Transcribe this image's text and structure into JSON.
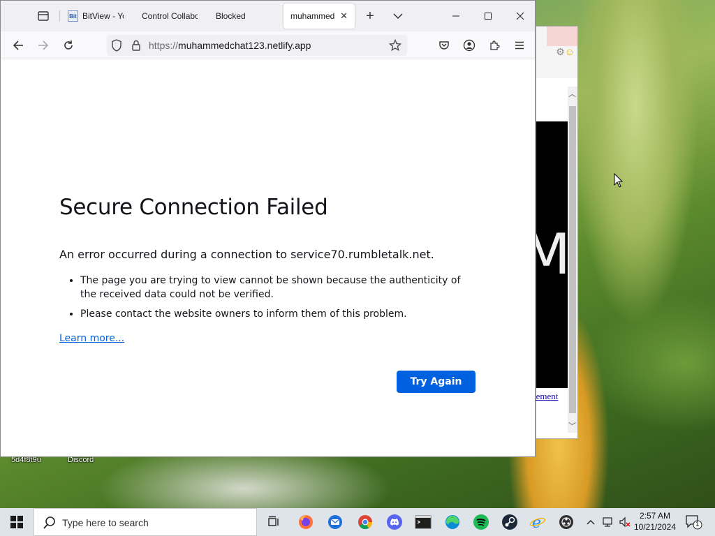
{
  "browser": {
    "tabs": [
      {
        "label": "BitView - Yo",
        "favicon": "Bit",
        "active": false
      },
      {
        "label": "Control Collabo",
        "active": false
      },
      {
        "label": "Blocked",
        "active": false
      },
      {
        "label": "muhammed",
        "active": true
      }
    ],
    "url": {
      "scheme": "https://",
      "host": "muhammedchat123.netlify.app"
    }
  },
  "error_page": {
    "title": "Secure Connection Failed",
    "intro": "An error occurred during a connection to service70.rumbletalk.net.",
    "bullets": [
      "The page you are trying to view cannot be shown because the authenticity of the received data could not be verified.",
      "Please contact the website owners to inform them of this problem."
    ],
    "learn_more": "Learn more...",
    "try_again": "Try Again"
  },
  "background_window": {
    "link_fragment": "tement",
    "glyph": "M"
  },
  "desktop": {
    "icons": [
      "5d4f8t9u",
      "Discord"
    ]
  },
  "taskbar": {
    "search_placeholder": "Type here to search",
    "time": "2:57 AM",
    "date": "10/21/2024",
    "notification_count": "1",
    "apps": [
      "task-view",
      "firefox",
      "thunderbird",
      "chrome",
      "discord",
      "terminal",
      "edge",
      "spotify",
      "steam",
      "internet-explorer",
      "obs"
    ]
  },
  "colors": {
    "accent": "#0061e0",
    "tab_bar": "#f0f0f4",
    "taskbar": "#dfe4ea"
  }
}
